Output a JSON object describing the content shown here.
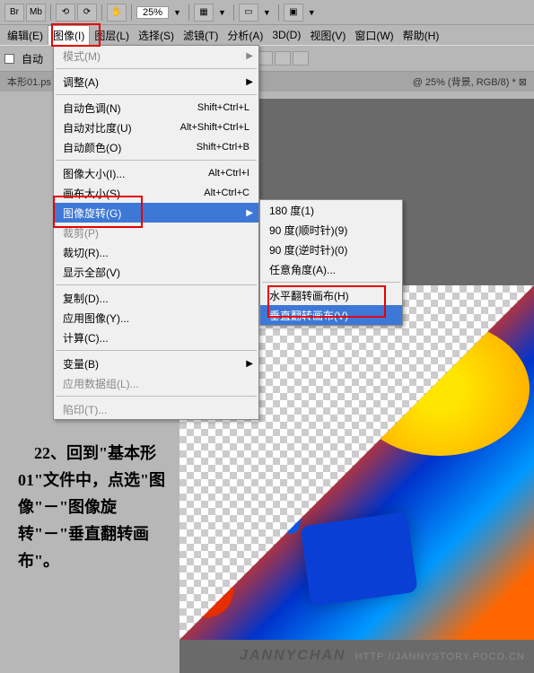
{
  "toolbar": {
    "br": "Br",
    "mb": "Mb",
    "zoom": "25%"
  },
  "menubar": {
    "items": [
      "编辑(E)",
      "图像(I)",
      "图层(L)",
      "选择(S)",
      "滤镜(T)",
      "分析(A)",
      "3D(D)",
      "视图(V)",
      "窗口(W)",
      "帮助(H)"
    ]
  },
  "optbar": {
    "auto_select": "自动",
    "auto_select_unchecked": "自动"
  },
  "tabs": {
    "left": "本形01.ps",
    "right": "@ 25% (背景, RGB/8) * ⊠"
  },
  "dropdown_main": [
    {
      "t": "item",
      "label": "模式(M)",
      "arrow": true,
      "dis": true
    },
    {
      "t": "sep"
    },
    {
      "t": "item",
      "label": "调整(A)",
      "arrow": true
    },
    {
      "t": "sep"
    },
    {
      "t": "item",
      "label": "自动色调(N)",
      "short": "Shift+Ctrl+L"
    },
    {
      "t": "item",
      "label": "自动对比度(U)",
      "short": "Alt+Shift+Ctrl+L"
    },
    {
      "t": "item",
      "label": "自动颜色(O)",
      "short": "Shift+Ctrl+B"
    },
    {
      "t": "sep"
    },
    {
      "t": "item",
      "label": "图像大小(I)...",
      "short": "Alt+Ctrl+I"
    },
    {
      "t": "item",
      "label": "画布大小(S)...",
      "short": "Alt+Ctrl+C"
    },
    {
      "t": "item",
      "label": "图像旋转(G)",
      "arrow": true,
      "hl": true
    },
    {
      "t": "item",
      "label": "裁剪(P)",
      "dis": true
    },
    {
      "t": "item",
      "label": "裁切(R)..."
    },
    {
      "t": "item",
      "label": "显示全部(V)"
    },
    {
      "t": "sep"
    },
    {
      "t": "item",
      "label": "复制(D)..."
    },
    {
      "t": "item",
      "label": "应用图像(Y)..."
    },
    {
      "t": "item",
      "label": "计算(C)..."
    },
    {
      "t": "sep"
    },
    {
      "t": "item",
      "label": "变量(B)",
      "arrow": true
    },
    {
      "t": "item",
      "label": "应用数据组(L)...",
      "dis": true
    },
    {
      "t": "sep"
    },
    {
      "t": "item",
      "label": "陷印(T)...",
      "dis": true
    }
  ],
  "dropdown_sub": [
    {
      "t": "item",
      "label": "180 度(1)"
    },
    {
      "t": "item",
      "label": "90 度(顺时针)(9)"
    },
    {
      "t": "item",
      "label": "90 度(逆时针)(0)"
    },
    {
      "t": "item",
      "label": "任意角度(A)..."
    },
    {
      "t": "sep"
    },
    {
      "t": "item",
      "label": "水平翻转画布(H)"
    },
    {
      "t": "item",
      "label": "垂直翻转画布(V)",
      "hl": true
    }
  ],
  "instruction": "　22、回到\"基本形01\"文件中，点选\"图像\"－\"图像旋转\"－\"垂直翻转画布\"。",
  "watermark": {
    "name": "JANNYCHAN",
    "url": "HTTP://JANNYSTORY.POCO.CN"
  }
}
